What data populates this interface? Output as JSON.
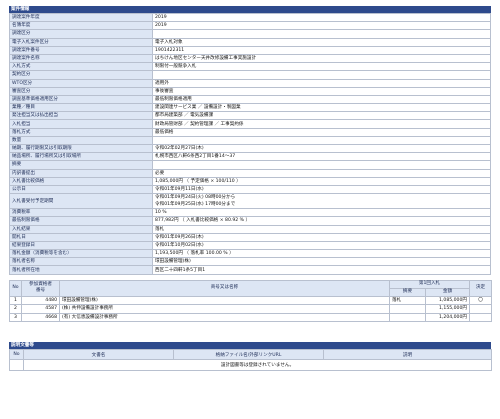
{
  "section_title": "案件情報",
  "fields": [
    {
      "label": "調達案件年度",
      "value": "2019"
    },
    {
      "label": "名簿年度",
      "value": "2019"
    },
    {
      "label": "調達区分",
      "value": ""
    },
    {
      "label": "電子入札案件区分",
      "value": "電子入札対象"
    },
    {
      "label": "調達案件番号",
      "value": "1901422311"
    },
    {
      "label": "調達案件名称",
      "value": "はちけん地区センター天井改修設備工事実施設計"
    },
    {
      "label": "入札方式",
      "value": "制限付一般競争入札"
    },
    {
      "label": "契約区分",
      "value": ""
    },
    {
      "label": "WTO区分",
      "value": "適用外"
    },
    {
      "label": "審査区分",
      "value": "事後審査"
    },
    {
      "label": "調査基準価格適用区分",
      "value": "最低制限価格適用"
    },
    {
      "label": "業種／種目",
      "value": "建設関連サービス業 ／ 設備設計・製図業"
    },
    {
      "label": "発注担当又は払出担当",
      "value": "都市局建築部 ／ 電気設備課"
    },
    {
      "label": "入札担当",
      "value": "財政局管財部 ／ 契約管理課 ／ 工事契約係"
    },
    {
      "label": "落札方式",
      "value": "最低価格"
    },
    {
      "label": "数量",
      "value": ""
    },
    {
      "label": "納期、履行期限又は引取期限",
      "value": "令和02年02月27日(木)"
    },
    {
      "label": "納品場所、履行場所又は引取場所",
      "value": "札幌市西区八軒6条西2丁目1番14～37"
    },
    {
      "label": "摘要",
      "value": ""
    },
    {
      "label": "内訳書提出",
      "value": "必要"
    },
    {
      "label": "入札書比較価格",
      "value": "1,085,000円 （ 予定価格 × 100/110 ）"
    },
    {
      "label": "公示日",
      "value": "令和01年09月11日(水)"
    },
    {
      "label": "入札書受付予定期間",
      "value": "令和01年09月24日(火) 08時00分から\n令和01年09月25日(水) 17時00分まで"
    },
    {
      "label": "消費税率",
      "value": "10 %"
    },
    {
      "label": "最低制限価格",
      "value": "877,982円 （ 入札書比較価格 × 80.92 % ）"
    },
    {
      "label": "入札結果",
      "value": "落札"
    },
    {
      "label": "開札日",
      "value": "令和01年09月26日(木)"
    },
    {
      "label": "結果登録日",
      "value": "令和01年10月02日(水)"
    },
    {
      "label": "落札金額（消費税等を含む）",
      "value": "1,193,500円 （ 落札率 100.00 % ）"
    },
    {
      "label": "落札者名称",
      "value": "環田設備管理(株)"
    },
    {
      "label": "落札者所在地",
      "value": "西区二十四軒1条5丁目1"
    }
  ],
  "bid_table": {
    "headers": {
      "no": "No",
      "code": "参加資格者\n番号",
      "name": "商号又は名称",
      "round1": "第1回入札",
      "remarks": "摘要",
      "amount": "金額",
      "decision": "決定"
    },
    "rows": [
      {
        "no": "1",
        "code": "4480",
        "name": "環田設備管理(株)",
        "remarks": "落札",
        "amount": "1,085,000円",
        "decision": "〇"
      },
      {
        "no": "2",
        "code": "4587",
        "name": "(株) 共伸設備設計事務所",
        "remarks": "",
        "amount": "1,155,000円",
        "decision": ""
      },
      {
        "no": "3",
        "code": "4668",
        "name": "(有) 大信恵設備設計事務所",
        "remarks": "",
        "amount": "1,204,000円",
        "decision": ""
      }
    ]
  },
  "docs_section_title": "説明文書等",
  "docs_table": {
    "headers": {
      "no": "No",
      "doc_name": "文書名",
      "file_link": "格納ファイル名/外部リンクURL",
      "description": "説明"
    },
    "empty_message": "設計図書等は登録されていません。"
  }
}
